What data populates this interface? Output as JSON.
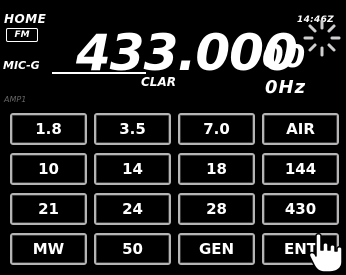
{
  "header": {
    "home_label": "HOME",
    "mode_badge": "FM",
    "mic_gain_label": "MIC-G",
    "amp_label": "AMP1",
    "clock": "14:46Z"
  },
  "frequency": {
    "main": "433.000",
    "sub": "00",
    "clar_label": "CLAR",
    "clar_offset": "0Hz"
  },
  "band_buttons": [
    "1.8",
    "3.5",
    "7.0",
    "AIR",
    "10",
    "14",
    "18",
    "144",
    "21",
    "24",
    "28",
    "430",
    "MW",
    "50",
    "GEN",
    "ENT"
  ],
  "icons": {
    "cursor": "hand-pointer-icon",
    "touch": "touch-sparkle-icon"
  }
}
